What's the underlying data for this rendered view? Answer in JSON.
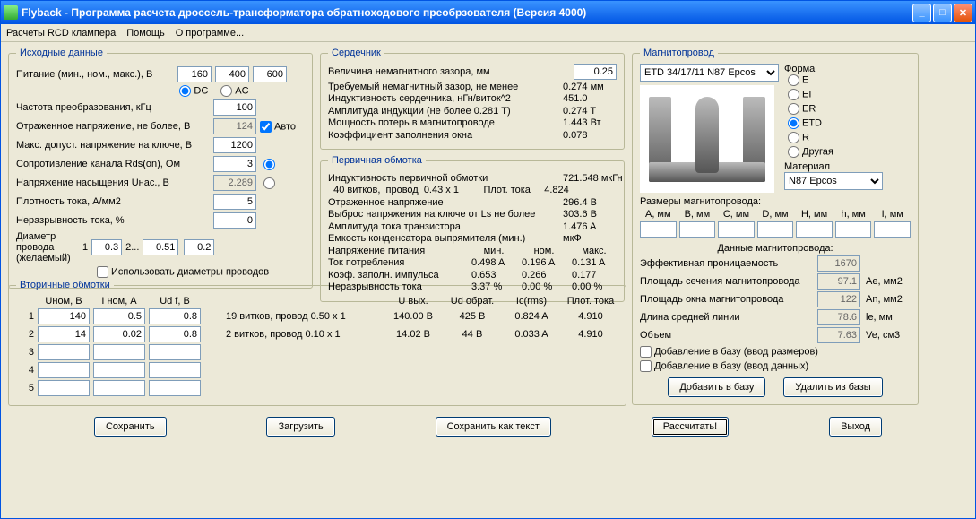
{
  "window": {
    "title": "Flyback - Программа расчета дроссель-трансформатора обратноходового преобрзователя (Версия 4000)"
  },
  "menu": {
    "rcd": "Расчеты RCD клампера",
    "help": "Помощь",
    "about": "О программе..."
  },
  "input": {
    "legend": "Исходные данные",
    "supply_label": "Питание (мин., ном., макс.), В",
    "supply_min": "160",
    "supply_nom": "400",
    "supply_max": "600",
    "dc": "DC",
    "ac": "AC",
    "freq_label": "Частота преобразования, кГц",
    "freq": "100",
    "vref_label": "Отраженное напряжение, не более, В",
    "vref": "124",
    "auto": "Авто",
    "vmax_label": "Макс. допуст. напряжение на ключе, В",
    "vmax": "1200",
    "rds_label": "Сопротивление канала Rds(on), Ом",
    "rds": "3",
    "usat_label": "Напряжение насыщения Uнас., В",
    "usat": "2.289",
    "jden_label": "Плотность тока, А/мм2",
    "jden": "5",
    "cont_label": "Неразрывность тока, %",
    "cont": "0",
    "diam_label1": "Диаметр",
    "diam_label2": "провода",
    "diam_label3": "(желаемый)",
    "diam_1": "1",
    "diam_v1": "0.3",
    "diam_2": "2...",
    "diam_v2": "0.51",
    "diam_v3": "0.2",
    "use_diam": "Использовать диаметры проводов"
  },
  "core": {
    "legend": "Сердечник",
    "gap_label": "Величина немагнитного зазора, мм",
    "gap": "0.25",
    "req_gap_label": "Требуемый немагнитный зазор, не менее",
    "req_gap": "0.274 мм",
    "ind_label": "Индуктивность сердечника, нГн/виток^2",
    "ind": "451.0",
    "bamp_label": "Амплитуда индукции    (не более 0.281 Т)",
    "bamp": "0.274 T",
    "ploss_label": "Мощность потерь в магнитопроводе",
    "ploss": "1.443 Вт",
    "kfill_label": "Коэффициент заполнения окна",
    "kfill": "0.078"
  },
  "primary": {
    "legend": "Первичная обмотка",
    "ind_label": "Индуктивность первичной обмотки",
    "ind": "721.548 мкГн",
    "turns": "  40 витков,  провод  0.43 x 1         Плот. тока     4.824",
    "vref_label": "Отраженное напряжение",
    "vref": "296.4 В",
    "vspike_label": "Выброс напряжения на ключе от Ls не более",
    "vspike": "303.6 В",
    "iamp_label": "Амплитуда тока транзистора",
    "iamp": "1.476 A",
    "cap_label": "Емкость конденсатора выпрямителя (мин.)",
    "cap": "мкФ",
    "head_min": "мин.",
    "head_nom": "ном.",
    "head_max": "макс.",
    "vsup_label": "Напряжение питания",
    "icon_label": "Ток потребления",
    "icon_min": "0.498 A",
    "icon_nom": "0.196 A",
    "icon_max": "0.131 A",
    "duty_label": "Коэф. заполн. импульса",
    "duty_min": "0.653",
    "duty_nom": "0.266",
    "duty_max": "0.177",
    "disc_label": "Неразрывность тока",
    "disc_min": "3.37 %",
    "disc_nom": "0.00 %",
    "disc_max": "0.00 %"
  },
  "secondary": {
    "legend": "Вторичные обмотки",
    "h_unom": "Uном, В",
    "h_inom": "I ном, A",
    "h_udf": "Ud f, В",
    "h_uvyh": "U вых.",
    "h_udobr": "Ud обрат.",
    "h_ic": "Ic(rms)",
    "h_plot": "Плот. тока",
    "rows": [
      {
        "idx": "1",
        "u": "140",
        "i": "0.5",
        "ud": "0.8",
        "desc": "19 витков, провод 0.50 x 1",
        "uv": "140.00 В",
        "udo": "425 В",
        "ic": "0.824 A",
        "pt": "4.910"
      },
      {
        "idx": "2",
        "u": "14",
        "i": "0.02",
        "ud": "0.8",
        "desc": "2 витков, провод 0.10 x 1",
        "uv": "14.02 В",
        "udo": "44 В",
        "ic": "0.033 A",
        "pt": "4.910"
      },
      {
        "idx": "3",
        "u": "",
        "i": "",
        "ud": "",
        "desc": "",
        "uv": "",
        "udo": "",
        "ic": "",
        "pt": ""
      },
      {
        "idx": "4",
        "u": "",
        "i": "",
        "ud": "",
        "desc": "",
        "uv": "",
        "udo": "",
        "ic": "",
        "pt": ""
      },
      {
        "idx": "5",
        "u": "",
        "i": "",
        "ud": "",
        "desc": "",
        "uv": "",
        "udo": "",
        "ic": "",
        "pt": ""
      }
    ]
  },
  "magneto": {
    "legend": "Магнитопровод",
    "core_select": "ETD 34/17/11 N87 Epcos",
    "shape_label": "Форма",
    "shapes": [
      "E",
      "EI",
      "ER",
      "ETD",
      "R",
      "Другая"
    ],
    "material_label": "Материал",
    "material": "N87 Epcos",
    "dim_label": "Размеры магнитопровода:",
    "dims": [
      "A, мм",
      "B, мм",
      "C, мм",
      "D, мм",
      "H, мм",
      "h, мм",
      "I, мм"
    ],
    "data_label": "Данные магнитопровода:",
    "perm_label": "Эффективная проницаемость",
    "perm": "1670",
    "area_label": "Площадь сечения магнитопровода",
    "area": "97.1",
    "area_u": "Ae, мм2",
    "win_label": "Площадь окна магнитопровода",
    "win": "122",
    "win_u": "An, мм2",
    "len_label": "Длина средней линии",
    "len": "78.6",
    "len_u": "le, мм",
    "vol_label": "Объем",
    "vol": "7.63",
    "vol_u": "Ve, см3",
    "add_dim": "Добавление в базу (ввод размеров)",
    "add_data": "Добавление в базу (ввод данных)",
    "btn_add": "Добавить в базу",
    "btn_del": "Удалить из базы"
  },
  "buttons": {
    "save": "Сохранить",
    "load": "Загрузить",
    "save_txt": "Сохранить как текст",
    "calc": "Рассчитать!",
    "exit": "Выход"
  }
}
